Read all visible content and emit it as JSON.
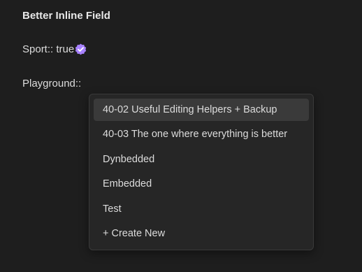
{
  "page": {
    "heading": "Better Inline Field"
  },
  "fields": {
    "sport": {
      "text": "Sport:: true",
      "icon": "check-circle-icon",
      "icon_color": "#a882ff"
    },
    "playground": {
      "text": "Playground::"
    }
  },
  "dropdown": {
    "selected_index": 0,
    "items": [
      {
        "label": "40-02 Useful Editing Helpers + Backup"
      },
      {
        "label": "40-03 The one where everything is better"
      },
      {
        "label": "Dynbedded"
      },
      {
        "label": "Embedded"
      },
      {
        "label": "Test"
      },
      {
        "label": "+ Create New"
      }
    ]
  },
  "colors": {
    "background": "#1e1e1e",
    "dropdown_background": "#262626",
    "selected_item": "#3a3a3a",
    "accent": "#a882ff"
  }
}
